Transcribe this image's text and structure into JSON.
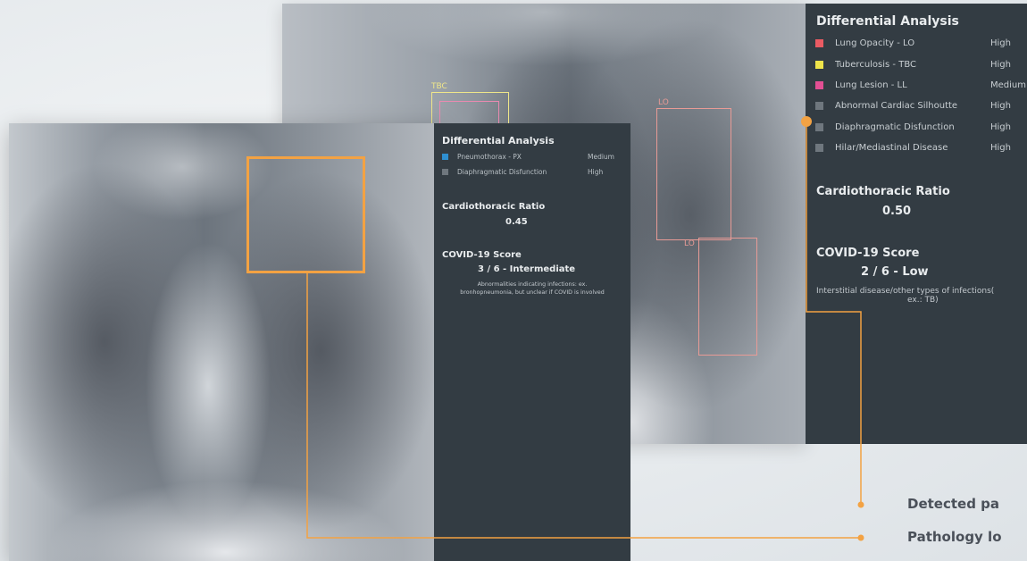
{
  "back_view": {
    "panel": {
      "title": "Differential Analysis",
      "findings": [
        {
          "name": "Lung Opacity - LO",
          "level": "High",
          "color": "#ea5b63"
        },
        {
          "name": "Tuberculosis - TBC",
          "level": "High",
          "color": "#efe44a"
        },
        {
          "name": "Lung Lesion - LL",
          "level": "Medium",
          "color": "#e24f93"
        },
        {
          "name": "Abnormal Cardiac Silhoutte",
          "level": "High",
          "color": "#6f777e"
        },
        {
          "name": "Diaphragmatic Disfunction",
          "level": "High",
          "color": "#6f777e"
        },
        {
          "name": "Hilar/Mediastinal Disease",
          "level": "High",
          "color": "#6f777e"
        }
      ],
      "ratio_title": "Cardiothoracic Ratio",
      "ratio_value": "0.50",
      "covid_title": "COVID-19 Score",
      "covid_value": "2 / 6 - Low",
      "covid_desc_1": "Interstitial disease/other types of infections(",
      "covid_desc_2": "ex.: TB)"
    },
    "box_labels": {
      "tbc": "TBC",
      "lo_top": "LO",
      "lo_bottom": "LO"
    }
  },
  "front_view": {
    "panel": {
      "title": "Differential Analysis",
      "findings": [
        {
          "name": "Pneumothorax - PX",
          "level": "Medium",
          "color": "#2e8fd0"
        },
        {
          "name": "Diaphragmatic Disfunction",
          "level": "High",
          "color": "#6f777e"
        }
      ],
      "ratio_title": "Cardiothoracic Ratio",
      "ratio_value": "0.45",
      "covid_title": "COVID-19 Score",
      "covid_value": "3 / 6 - Intermediate",
      "covid_desc_1": "Abnormalities indicating infections: ex.",
      "covid_desc_2": "bronhopneumonia, but unclear if COVID is involved"
    }
  },
  "callouts": {
    "detected": "Detected pa",
    "pathology": "Pathology lo"
  },
  "colors": {
    "accent": "#f3a243",
    "panel_bg": "#333c43"
  }
}
